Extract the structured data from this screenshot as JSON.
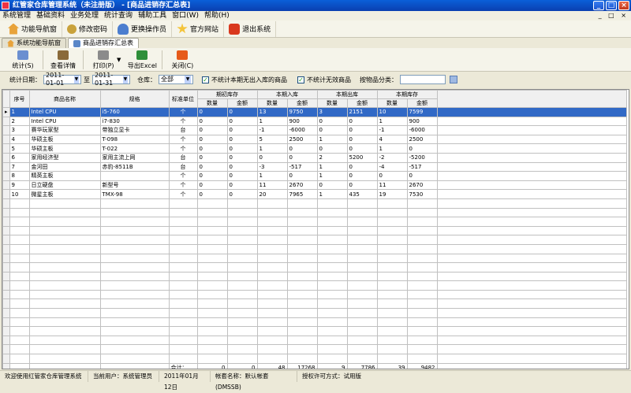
{
  "window": {
    "title": "红管家仓库管理系统（未注册版） - [商品进销存汇总表]"
  },
  "menu": [
    "系统管理",
    "基础资料",
    "业务处理",
    "统计查询",
    "辅助工具",
    "窗口(W)",
    "帮助(H)"
  ],
  "top_buttons": [
    "功能导航窗",
    "修改密码",
    "更换操作员",
    "官方网站",
    "退出系统"
  ],
  "tabs": [
    "系统功能导航窗",
    "商品进销存汇总表"
  ],
  "toolbar": [
    "统计(S)",
    "查看详情",
    "打印(P)",
    "导出Excel",
    "关闭(C)"
  ],
  "filter": {
    "date_label": "统计日期：",
    "date_from": "2011-01-01",
    "to_label": "至",
    "date_to": "2011-01-31",
    "warehouse_label": "仓库：",
    "warehouse": "全部",
    "check1": "不统计本期无出入库的商品",
    "check2": "不统计无效商品",
    "category_label": "按物品分类："
  },
  "grid": {
    "headers": {
      "seq": "序号",
      "name": "商品名称",
      "spec": "规格",
      "unit": "标准单位",
      "opening": "期初库存",
      "in": "本期入库",
      "out": "本期出库",
      "closing": "本期库存",
      "qty": "数量",
      "amount": "金额"
    },
    "rows": [
      [
        "1",
        "Intel CPU",
        "i5-760",
        "个",
        "0",
        "0",
        "13",
        "9750",
        "3",
        "2151",
        "10",
        "7599"
      ],
      [
        "2",
        "Intel CPU",
        "i7-830",
        "个",
        "0",
        "0",
        "1",
        "900",
        "0",
        "0",
        "1",
        "900"
      ],
      [
        "3",
        "赛华玩家型",
        "带独立显卡",
        "台",
        "0",
        "0",
        "-1",
        "-6000",
        "0",
        "0",
        "-1",
        "-6000"
      ],
      [
        "4",
        "华硕主板",
        "T-098",
        "个",
        "0",
        "0",
        "5",
        "2500",
        "1",
        "0",
        "4",
        "2500"
      ],
      [
        "5",
        "华硕主板",
        "T-022",
        "个",
        "0",
        "0",
        "1",
        "0",
        "0",
        "0",
        "1",
        "0"
      ],
      [
        "6",
        "家用经济型",
        "家用主流上网",
        "台",
        "0",
        "0",
        "0",
        "0",
        "2",
        "5200",
        "-2",
        "-5200"
      ],
      [
        "7",
        "金河田",
        "赤豹-8511B",
        "台",
        "0",
        "0",
        "-3",
        "-517",
        "1",
        "0",
        "-4",
        "-517"
      ],
      [
        "8",
        "精英主板",
        "",
        "个",
        "0",
        "0",
        "1",
        "0",
        "1",
        "0",
        "0",
        "0"
      ],
      [
        "9",
        "日立硬盘",
        "新型号",
        "个",
        "0",
        "0",
        "11",
        "2670",
        "0",
        "0",
        "11",
        "2670"
      ],
      [
        "10",
        "微星主板",
        "TMX-98",
        "个",
        "0",
        "0",
        "20",
        "7965",
        "1",
        "435",
        "19",
        "7530"
      ]
    ],
    "totals": {
      "label": "合计：",
      "values": [
        "0",
        "0",
        "48",
        "17268",
        "9",
        "7786",
        "39",
        "9482"
      ]
    }
  },
  "status": {
    "welcome": "欢迎使用红管家仓库管理系统",
    "user": "当前用户：系统管理员",
    "date": "2011年01月12日",
    "account": "帐套名称：默认帐套(DMSSB)",
    "license": "授权许可方式：试用版"
  }
}
